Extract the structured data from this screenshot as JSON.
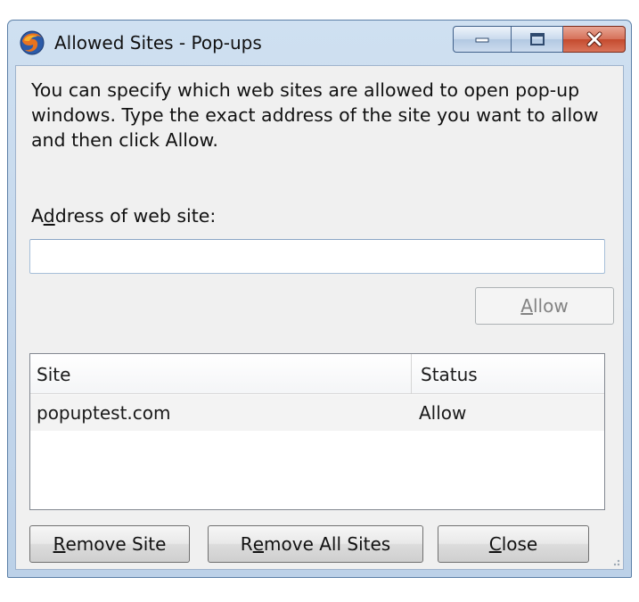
{
  "window": {
    "title": "Allowed Sites - Pop-ups",
    "app_icon": "firefox-icon"
  },
  "caption_buttons": {
    "minimize_icon": "minimize-icon",
    "maximize_icon": "maximize-icon",
    "close_icon": "close-icon",
    "close_color": "#c44a2e"
  },
  "description": "You can specify which web sites are allowed to open pop-up windows. Type the exact address of the site you want to allow and then click Allow.",
  "address": {
    "label_pre": "A",
    "label_accel": "d",
    "label_post": "dress of web site:",
    "value": "",
    "placeholder": ""
  },
  "allow_button": {
    "accel": "A",
    "rest": "llow",
    "disabled": true
  },
  "list": {
    "columns": [
      "Site",
      "Status"
    ],
    "rows": [
      {
        "site": "popuptest.com",
        "status": "Allow"
      }
    ]
  },
  "buttons": {
    "remove_site": {
      "accel": "R",
      "rest": "emove Site"
    },
    "remove_all": {
      "pre": "R",
      "accel": "e",
      "rest": "move All Sites"
    },
    "close": {
      "accel": "C",
      "rest": "lose"
    }
  }
}
